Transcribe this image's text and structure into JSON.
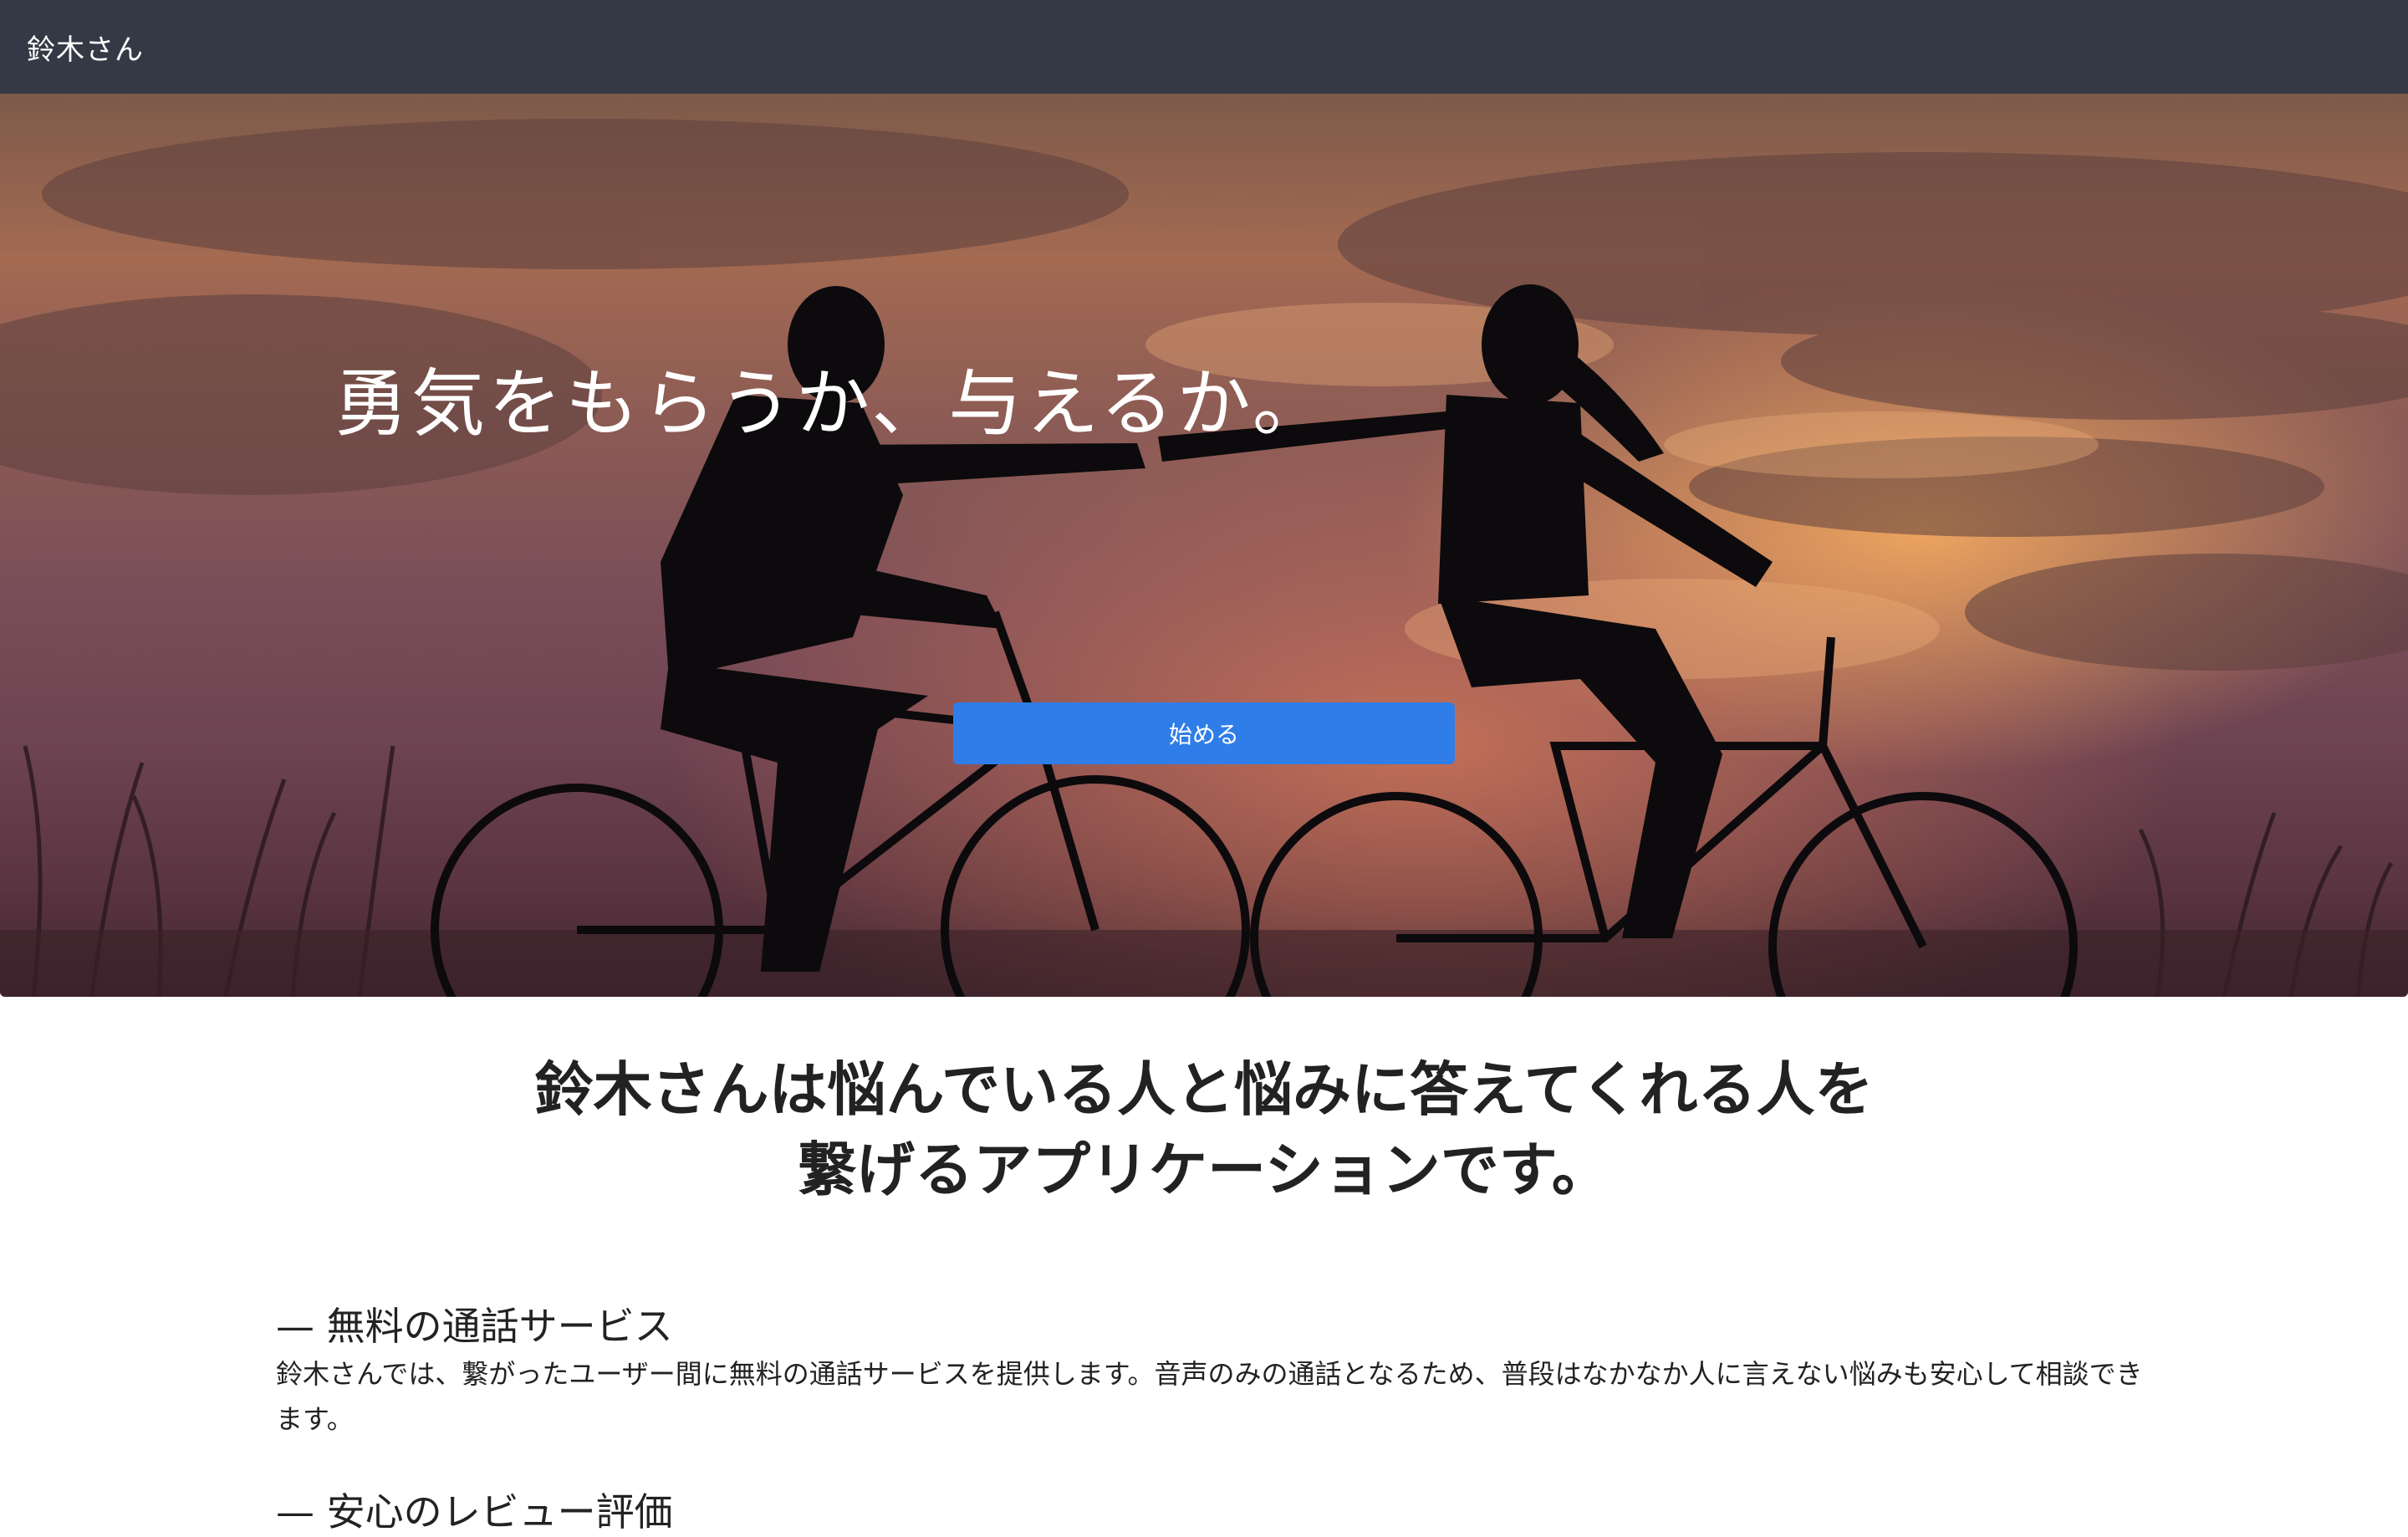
{
  "navbar": {
    "brand": "鈴木さん"
  },
  "hero": {
    "headline": "勇気をもらうか、与えるか。",
    "start_button": "始める"
  },
  "intro": {
    "line1": "鈴木さんは悩んでいる人と悩みに答えてくれる人を",
    "line2": "繋げるアプリケーションです。"
  },
  "features": [
    {
      "title": "— 無料の通話サービス",
      "body": "鈴木さんでは、繋がったユーザー間に無料の通話サービスを提供します。音声のみの通話となるため、普段はなかなか人に言えない悩みも安心して相談できます。"
    },
    {
      "title": "— 安心のレビュー評価"
    }
  ],
  "colors": {
    "navbar": "#343a45",
    "primary_button": "#2f7de8"
  }
}
